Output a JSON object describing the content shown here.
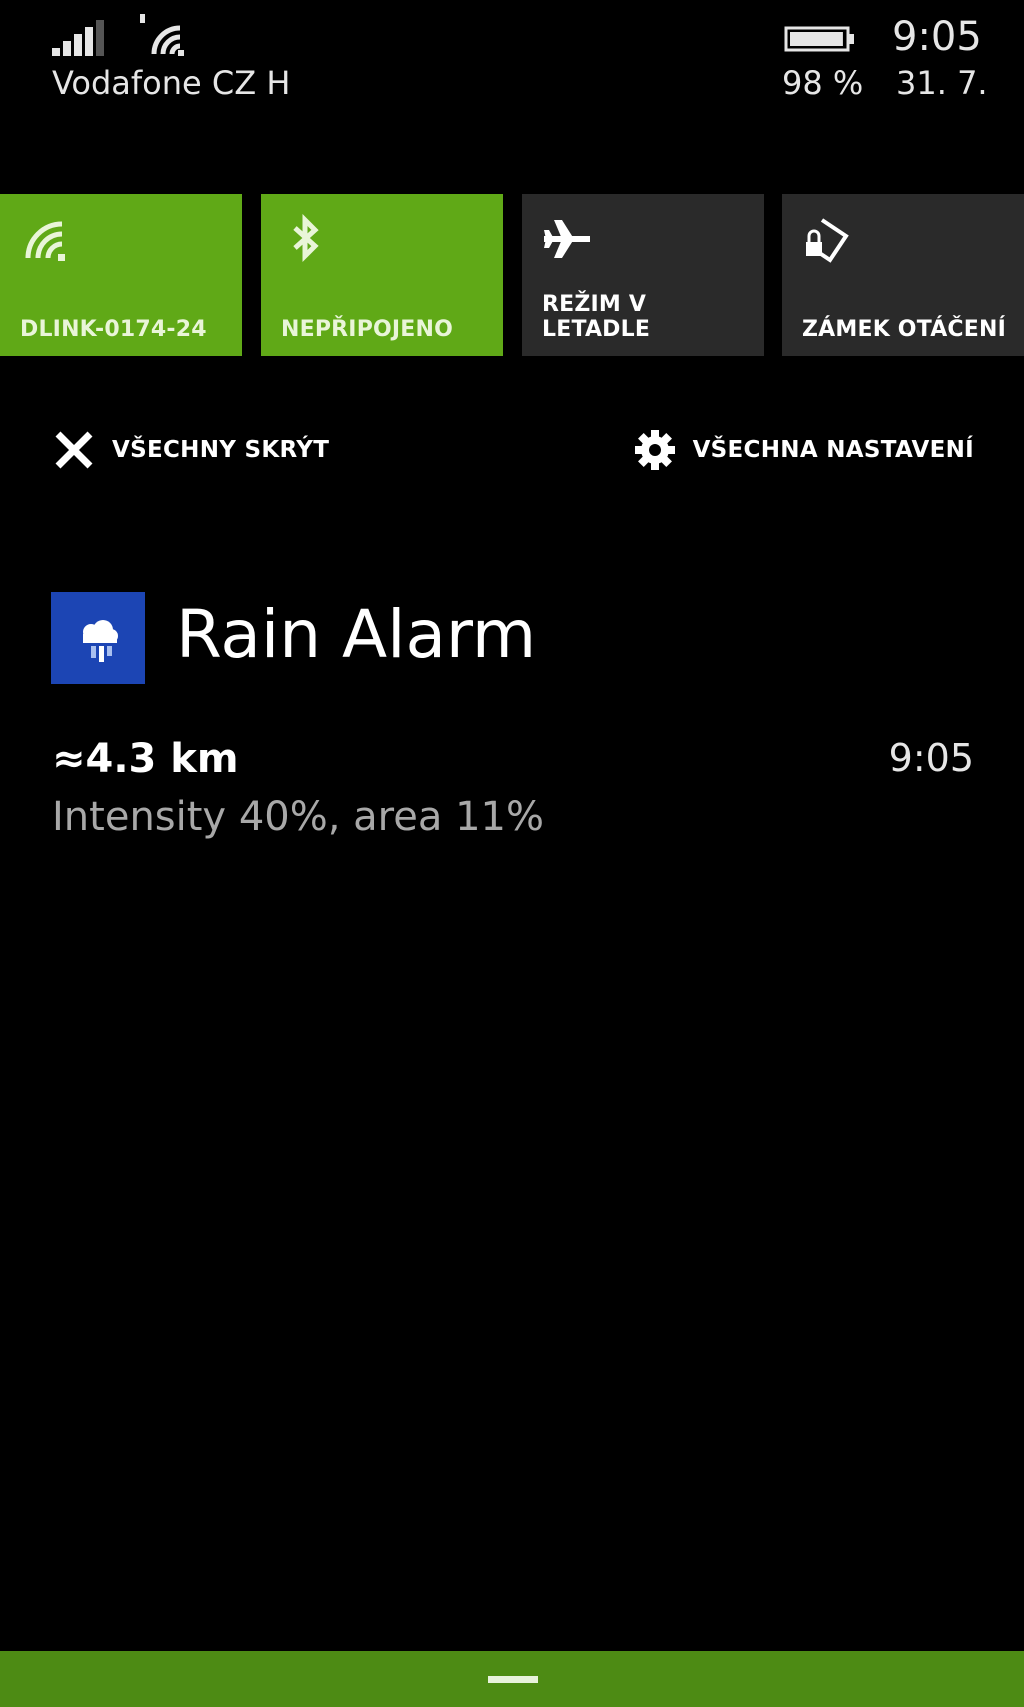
{
  "status_bar": {
    "carrier": "Vodafone CZ H",
    "battery_percent": "98 %",
    "battery_level": 98,
    "time": "9:05",
    "date": "31. 7."
  },
  "quick_actions": [
    {
      "label": "DLINK-0174-24",
      "icon": "wifi-icon",
      "active": true
    },
    {
      "label": "NEPŘIPOJENO",
      "icon": "bluetooth-icon",
      "active": true
    },
    {
      "label": "REŽIM V\nLETADLE",
      "icon": "airplane-icon",
      "active": false
    },
    {
      "label": "ZÁMEK OTÁČENÍ",
      "icon": "rotation-lock-icon",
      "active": false
    }
  ],
  "actions": {
    "hide_all": "VŠECHNY SKRÝT",
    "all_settings": "VŠECHNA NASTAVENÍ"
  },
  "notification": {
    "app_name": "Rain Alarm",
    "app_icon": "rain-alarm-app-icon",
    "title": "≈4.3 km",
    "time": "9:05",
    "body": "Intensity 40%, area 11%"
  },
  "colors": {
    "accent": "#60a917",
    "bottom_bar": "#4d8b14",
    "tile_inactive": "#2a2a2a",
    "app_icon_bg": "#1c45b4",
    "secondary_text": "#a8a8a8"
  }
}
